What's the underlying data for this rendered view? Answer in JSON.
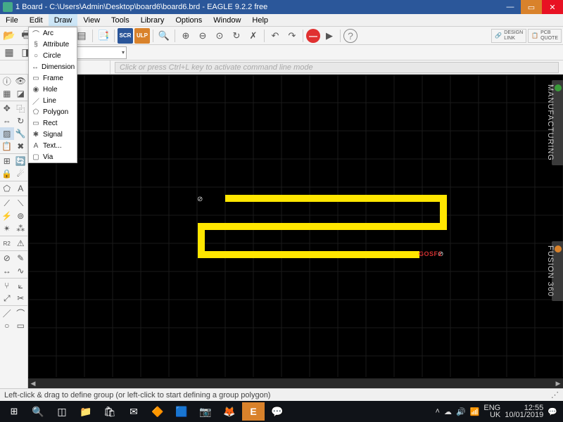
{
  "title": "1 Board - C:\\Users\\Admin\\Desktop\\board6\\board6.brd - EAGLE 9.2.2 free",
  "menubar": [
    "File",
    "Edit",
    "Draw",
    "View",
    "Tools",
    "Library",
    "Options",
    "Window",
    "Help"
  ],
  "active_menu_index": 2,
  "draw_menu": [
    {
      "icon": "⌒",
      "label": "Arc"
    },
    {
      "icon": "§",
      "label": "Attribute"
    },
    {
      "icon": "○",
      "label": "Circle"
    },
    {
      "icon": "↔",
      "label": "Dimension"
    },
    {
      "icon": "▭",
      "label": "Frame"
    },
    {
      "icon": "◉",
      "label": "Hole"
    },
    {
      "icon": "／",
      "label": "Line"
    },
    {
      "icon": "⬠",
      "label": "Polygon"
    },
    {
      "icon": "▭",
      "label": "Rect"
    },
    {
      "icon": "✱",
      "label": "Signal"
    },
    {
      "icon": "A",
      "label": "Text..."
    },
    {
      "icon": "▢",
      "label": "Via"
    }
  ],
  "toolbar1": {
    "scr": "SCR",
    "ulp": "ULP",
    "design_link": "DESIGN\nLINK",
    "pcb_quote": "PCB\nQUOTE"
  },
  "cmd_placeholder": "Click or press Ctrl+L key to activate command line mode",
  "right_tabs": [
    "MANUFACTURING",
    "FUSION 360"
  ],
  "status_text": "Left-click & drag to define group (or left-click to start defining a group polygon)",
  "tray": {
    "lang1": "ENG",
    "lang2": "UK",
    "time": "12:55",
    "date": "10/01/2019"
  },
  "canvas": {
    "red_label": "GOSF1",
    "marker1": "⊘",
    "marker2": "⊘"
  }
}
